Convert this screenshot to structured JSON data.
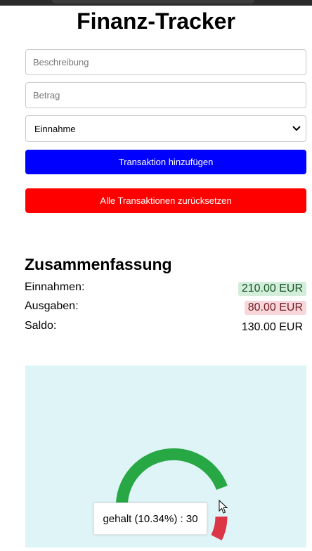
{
  "app": {
    "title": "Finanz-Tracker"
  },
  "form": {
    "description": {
      "value": "",
      "placeholder": "Beschreibung"
    },
    "amount": {
      "value": "",
      "placeholder": "Betrag"
    },
    "type": {
      "selected": "Einnahme"
    },
    "add_button": "Transaktion hinzufügen",
    "reset_button": "Alle Transaktionen zurücksetzen"
  },
  "summary": {
    "title": "Zusammenfassung",
    "income": {
      "label": "Einnahmen:",
      "value": "210.00 EUR"
    },
    "expenses": {
      "label": "Ausgaben:",
      "value": "80.00 EUR"
    },
    "balance": {
      "label": "Saldo:",
      "value": "130.00 EUR"
    }
  },
  "chart_data": {
    "type": "pie",
    "variant": "doughnut",
    "visible_segments": [
      {
        "color": "#28a745"
      },
      {
        "color": "#dc3545"
      }
    ],
    "tooltip": "gehalt (10.34%) : 30"
  },
  "colors": {
    "add_button": "#0000ff",
    "reset_button": "#ff0000",
    "chart_background": "#def4f7"
  },
  "icons": {
    "select_arrow": "chevron-down-icon",
    "cursor": "pointer-cursor-icon"
  }
}
